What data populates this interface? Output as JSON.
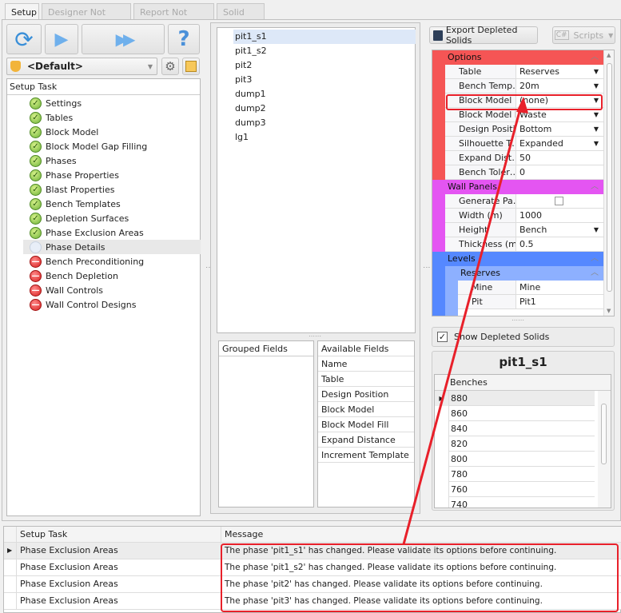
{
  "tabs": [
    {
      "label": "Setup"
    },
    {
      "label": "Designer Not Ready"
    },
    {
      "label": "Report Not Ready"
    },
    {
      "label": "Solid Lab"
    }
  ],
  "toolbar": {
    "help_label": "?"
  },
  "profile": {
    "value": "<Default>"
  },
  "tasks": {
    "header": "Setup Task",
    "items": [
      {
        "label": "Settings",
        "status": "ok"
      },
      {
        "label": "Tables",
        "status": "ok"
      },
      {
        "label": "Block Model",
        "status": "ok"
      },
      {
        "label": "Block Model Gap Filling",
        "status": "ok"
      },
      {
        "label": "Phases",
        "status": "ok"
      },
      {
        "label": "Phase Properties",
        "status": "ok"
      },
      {
        "label": "Blast Properties",
        "status": "ok"
      },
      {
        "label": "Bench Templates",
        "status": "ok"
      },
      {
        "label": "Depletion Surfaces",
        "status": "ok"
      },
      {
        "label": "Phase Exclusion Areas",
        "status": "ok"
      },
      {
        "label": "Phase Details",
        "status": "pending"
      },
      {
        "label": "Bench Preconditioning",
        "status": "error"
      },
      {
        "label": "Bench Depletion",
        "status": "error"
      },
      {
        "label": "Wall Controls",
        "status": "error"
      },
      {
        "label": "Wall Control Designs",
        "status": "error"
      }
    ]
  },
  "phases": [
    "pit1_s1",
    "pit1_s2",
    "pit2",
    "pit3",
    "dump1",
    "dump2",
    "dump3",
    "lg1"
  ],
  "grouped_fields": {
    "header": "Grouped Fields"
  },
  "available_fields": {
    "header": "Available Fields",
    "items": [
      "Name",
      "Table",
      "Design Position",
      "Block Model",
      "Block Model Fill",
      "Expand Distance",
      "Increment Template"
    ]
  },
  "export_button": "Export Depleted Solids",
  "scripts_button": "Scripts",
  "properties": {
    "options": {
      "title": "Options",
      "color": "#f55555",
      "rows": [
        {
          "name": "Table",
          "value": "Reserves",
          "dropdown": true
        },
        {
          "name": "Bench Temp…",
          "value": "20m",
          "dropdown": true
        },
        {
          "name": "Block Model",
          "value": "(none)",
          "dropdown": true
        },
        {
          "name": "Block Model Fill",
          "value": "Waste",
          "dropdown": true
        },
        {
          "name": "Design Positi…",
          "value": "Bottom",
          "dropdown": true
        },
        {
          "name": "Silhouette T…",
          "value": "Expanded",
          "dropdown": true
        },
        {
          "name": "Expand Dist…",
          "value": "50"
        },
        {
          "name": "Bench Toler…",
          "value": "0"
        }
      ]
    },
    "wall_panels": {
      "title": "Wall Panels",
      "color": "#e455f2",
      "rows": [
        {
          "name": "Generate Pa…",
          "value": ""
        },
        {
          "name": "Width (m)",
          "value": "1000"
        },
        {
          "name": "Height",
          "value": "Bench",
          "dropdown": true
        },
        {
          "name": "Thickness (m)",
          "value": "0.5"
        }
      ]
    },
    "levels": {
      "title": "Levels",
      "color": "#5588ff",
      "sub_title": "Reserves",
      "sub_color": "#8db0ff",
      "rows": [
        {
          "name": "Mine",
          "value": "Mine"
        },
        {
          "name": "Pit",
          "value": "Pit1"
        }
      ]
    }
  },
  "show_depleted": {
    "label": "Show Depleted Solids",
    "checked": true
  },
  "benches": {
    "title": "pit1_s1",
    "header": "Benches",
    "values": [
      "880",
      "860",
      "840",
      "820",
      "800",
      "780",
      "760",
      "740"
    ]
  },
  "messages": {
    "headers": [
      "Setup Task",
      "Message"
    ],
    "rows": [
      {
        "task": "Phase Exclusion Areas",
        "message": "The phase 'pit1_s1' has changed. Please validate its options before continuing."
      },
      {
        "task": "Phase Exclusion Areas",
        "message": "The phase 'pit1_s2' has changed. Please validate its options before continuing."
      },
      {
        "task": "Phase Exclusion Areas",
        "message": "The phase 'pit2' has changed. Please validate its options before continuing."
      },
      {
        "task": "Phase Exclusion Areas",
        "message": "The phase 'pit3' has changed. Please validate its options before continuing."
      }
    ]
  }
}
